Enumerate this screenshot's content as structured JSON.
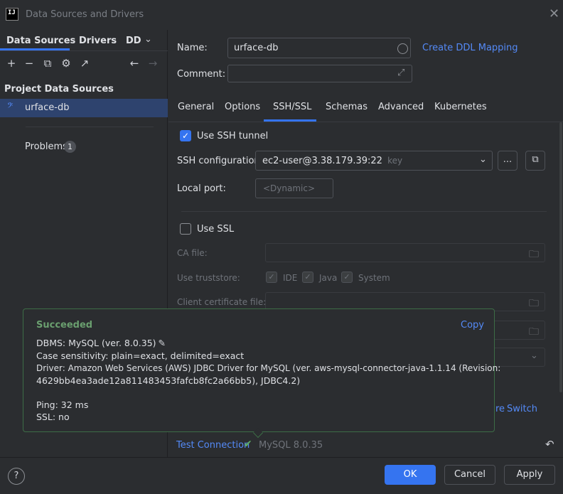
{
  "window": {
    "title": "Data Sources and Drivers",
    "app_icon": "IJ"
  },
  "left": {
    "tabs": [
      "Data Sources",
      "Drivers",
      "DD"
    ],
    "section_title": "Project Data Sources",
    "data_source": "urface-db",
    "problems_label": "Problems",
    "problems_count": "1"
  },
  "right": {
    "name_label": "Name:",
    "name_value": "urface-db",
    "create_ddl": "Create DDL Mapping",
    "comment_label": "Comment:",
    "tabs": [
      "General",
      "Options",
      "SSH/SSL",
      "Schemas",
      "Advanced",
      "Kubernetes"
    ],
    "active_tab": "SSH/SSL",
    "use_ssh": "Use SSH tunnel",
    "ssh_config_label": "SSH configuration:",
    "ssh_config_value": "ec2-user@3.38.179.39:22",
    "ssh_config_key": "key",
    "more_button": "...",
    "local_port_label": "Local port:",
    "local_port_placeholder": "<Dynamic>",
    "use_ssl": "Use SSL",
    "ca_file_label": "CA file:",
    "truststore_label": "Use truststore:",
    "truststore_opts": [
      "IDE",
      "Java",
      "System"
    ],
    "client_cert_label": "Client certificate file:",
    "partial_link_1": "re",
    "partial_link_2": "Switch"
  },
  "popup": {
    "status": "Succeeded",
    "copy": "Copy",
    "lines": [
      "DBMS: MySQL (ver. 8.0.35)",
      "Case sensitivity: plain=exact, delimited=exact",
      "Driver: Amazon Web Services (AWS) JDBC Driver for MySQL (ver. aws-mysql-connector-java-1.1.14 (Revision:",
      "4629bb4ea3ade12a811483453fafcb8fc2a66bb5), JDBC4.2)",
      "Ping: 32 ms",
      "SSL: no"
    ]
  },
  "status_strip": {
    "test_connection": "Test Connection",
    "mysql_version": "MySQL 8.0.35"
  },
  "footer": {
    "help": "?",
    "ok": "OK",
    "cancel": "Cancel",
    "apply": "Apply"
  },
  "colors": {
    "accent": "#3574f0",
    "success": "#5fad65",
    "link": "#548af7"
  }
}
